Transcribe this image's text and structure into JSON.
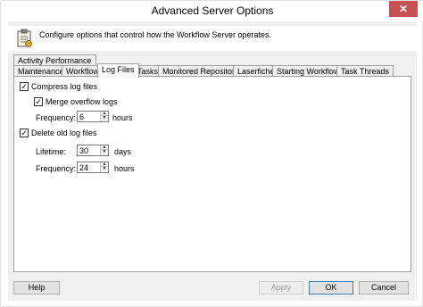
{
  "window": {
    "title": "Advanced Server Options",
    "close_symbol": "✕"
  },
  "header": {
    "icon": "clipboard-settings-icon",
    "text": "Configure options that control how the Workflow Server operates."
  },
  "tabs": {
    "row1": [
      {
        "label": "Activity Performance"
      }
    ],
    "row2": [
      {
        "label": "Maintenance"
      },
      {
        "label": "Workflow"
      },
      {
        "label": "Log Files",
        "active": true
      },
      {
        "label": "Tasks"
      },
      {
        "label": "Monitored Repositories"
      },
      {
        "label": "Laserfiche"
      },
      {
        "label": "Starting Workflows"
      },
      {
        "label": "Task Threads"
      }
    ]
  },
  "log_files": {
    "compress": {
      "label": "Compress log files",
      "checked": true
    },
    "merge": {
      "label": "Merge overflow logs",
      "checked": true
    },
    "compress_frequency": {
      "label": "Frequency:",
      "value": "6",
      "unit": "hours"
    },
    "delete": {
      "label": "Delete old log files",
      "checked": true
    },
    "lifetime": {
      "label": "Lifetime:",
      "value": "30",
      "unit": "days"
    },
    "delete_frequency": {
      "label": "Frequency:",
      "value": "24",
      "unit": "hours"
    }
  },
  "buttons": {
    "help": "Help",
    "apply": "Apply",
    "ok": "OK",
    "cancel": "Cancel"
  },
  "symbols": {
    "check": "✓",
    "up": "▲",
    "down": "▼"
  }
}
